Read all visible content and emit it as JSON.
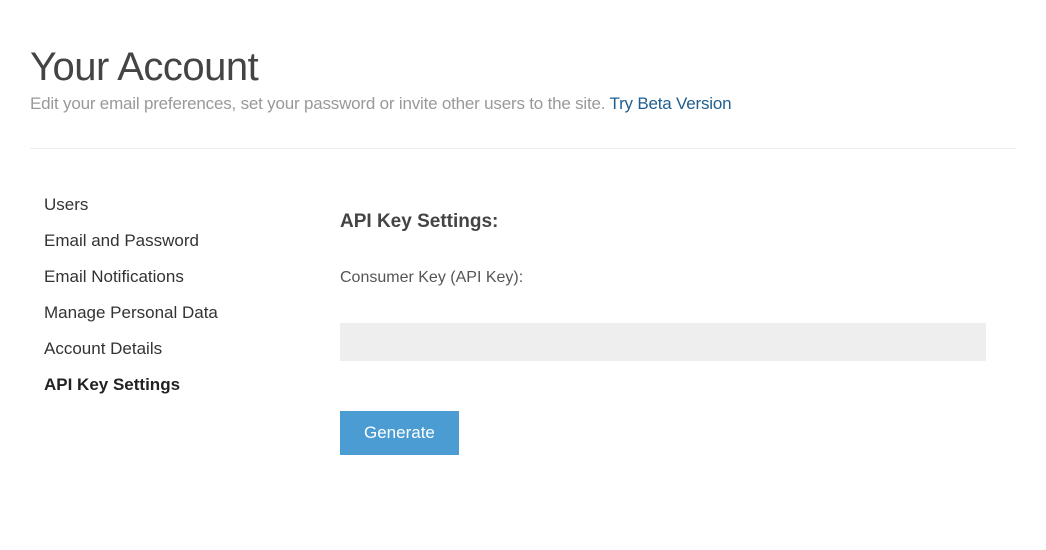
{
  "header": {
    "title": "Your Account",
    "subtitle_text": "Edit your email preferences, set your password or invite other users to the site. ",
    "beta_link": "Try Beta Version"
  },
  "sidebar": {
    "items": [
      {
        "label": "Users",
        "active": false
      },
      {
        "label": "Email and Password",
        "active": false
      },
      {
        "label": "Email Notifications",
        "active": false
      },
      {
        "label": "Manage Personal Data",
        "active": false
      },
      {
        "label": "Account Details",
        "active": false
      },
      {
        "label": "API Key Settings",
        "active": true
      }
    ]
  },
  "main": {
    "section_title": "API Key Settings:",
    "field_label": "Consumer Key (API Key):",
    "field_value": "",
    "generate_button": "Generate"
  }
}
